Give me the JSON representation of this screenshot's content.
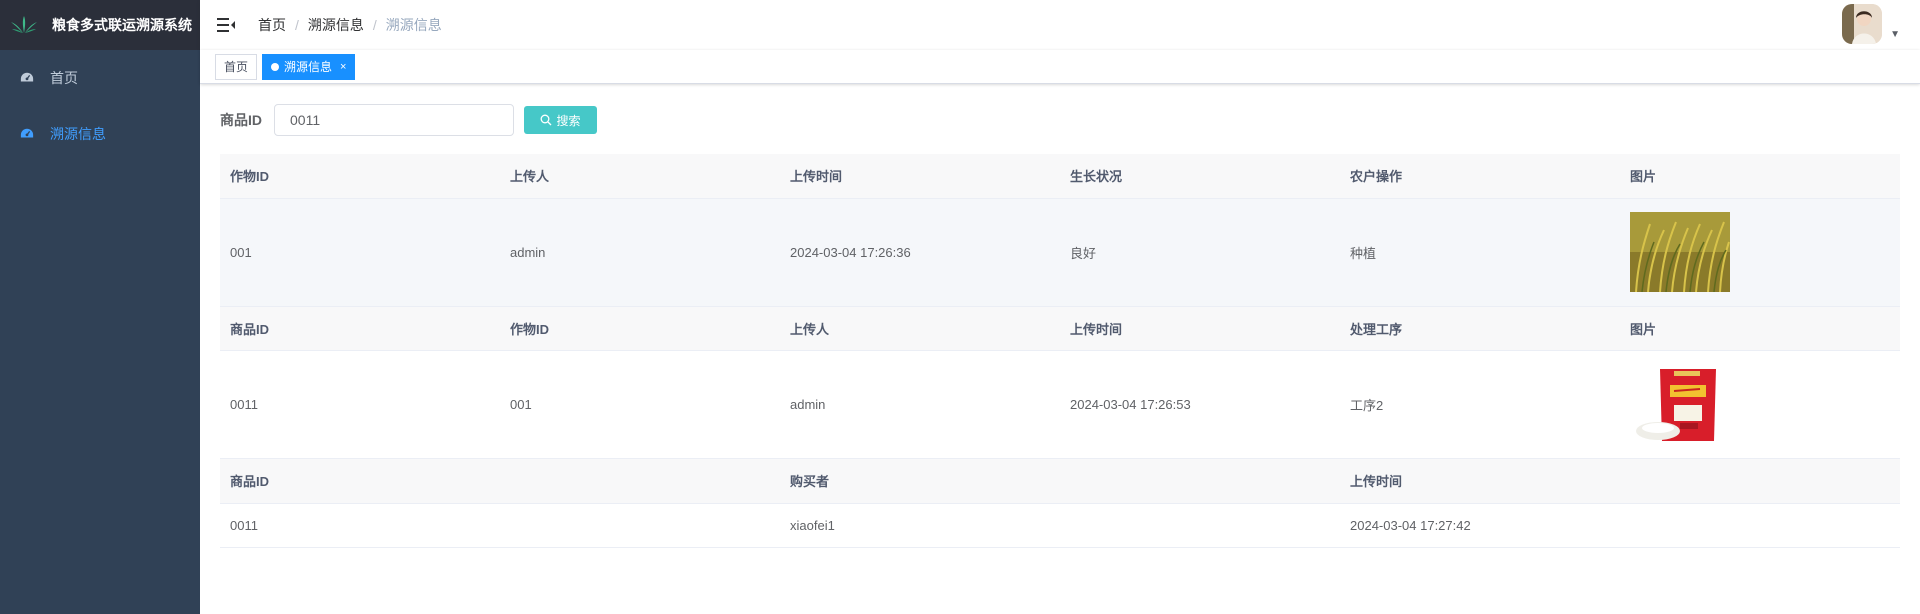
{
  "app": {
    "title": "粮食多式联运溯源系统"
  },
  "sidebar": {
    "items": [
      {
        "label": "首页",
        "icon": "dashboard-icon",
        "active": false
      },
      {
        "label": "溯源信息",
        "icon": "dashboard-icon",
        "active": true
      }
    ]
  },
  "navbar": {
    "breadcrumb": [
      "首页",
      "溯源信息",
      "溯源信息"
    ]
  },
  "tags": [
    {
      "label": "首页",
      "active": false
    },
    {
      "label": "溯源信息",
      "active": true,
      "close": "×"
    }
  ],
  "search": {
    "label": "商品ID",
    "value": "0011",
    "button": "搜索"
  },
  "crop_table": {
    "headers": [
      "作物ID",
      "上传人",
      "上传时间",
      "生长状况",
      "农户操作",
      "图片"
    ],
    "row": [
      "001",
      "admin",
      "2024-03-04 17:26:36",
      "良好",
      "种植"
    ],
    "image": "rice-field-image"
  },
  "process_table": {
    "headers": [
      "商品ID",
      "作物ID",
      "上传人",
      "上传时间",
      "处理工序",
      "图片"
    ],
    "row": [
      "0011",
      "001",
      "admin",
      "2024-03-04 17:26:53",
      "工序2"
    ],
    "image": "rice-bag-image"
  },
  "purchase_table": {
    "headers": [
      "商品ID",
      "购买者",
      "上传时间"
    ],
    "row": [
      "0011",
      "xiaofei1",
      "2024-03-04 17:27:42"
    ]
  },
  "colors": {
    "sidebar_bg": "#304156",
    "logo_bg": "#2b2f3a",
    "accent": "#409eff",
    "tag_active": "#1890ff",
    "search_button": "#46c8c8"
  }
}
